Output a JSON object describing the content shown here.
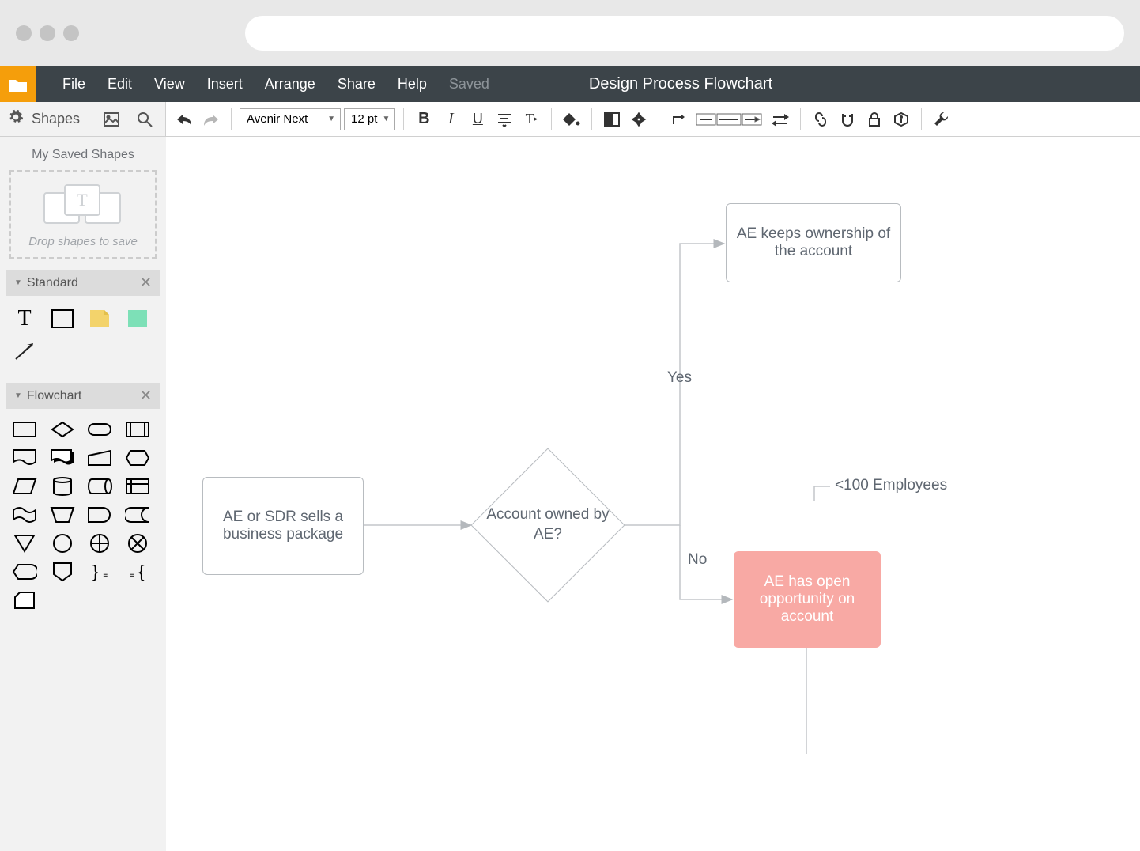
{
  "menubar": {
    "items": [
      "File",
      "Edit",
      "View",
      "Insert",
      "Arrange",
      "Share",
      "Help"
    ],
    "status": "Saved",
    "title": "Design Process Flowchart"
  },
  "sidebar": {
    "shapes_label": "Shapes",
    "drop_title": "My Saved Shapes",
    "drop_hint": "Drop shapes to save",
    "panels": {
      "standard": "Standard",
      "flowchart": "Flowchart"
    }
  },
  "toolbar": {
    "font": "Avenir Next",
    "size": "12 pt"
  },
  "diagram": {
    "nodes": {
      "start": "AE or SDR sells a business package",
      "decision": "Account owned by AE?",
      "yes_out": "AE keeps ownership of the account",
      "no_out": "AE has open opportunity on account",
      "annotation": "<100 Employees"
    },
    "labels": {
      "yes": "Yes",
      "no": "No"
    }
  }
}
